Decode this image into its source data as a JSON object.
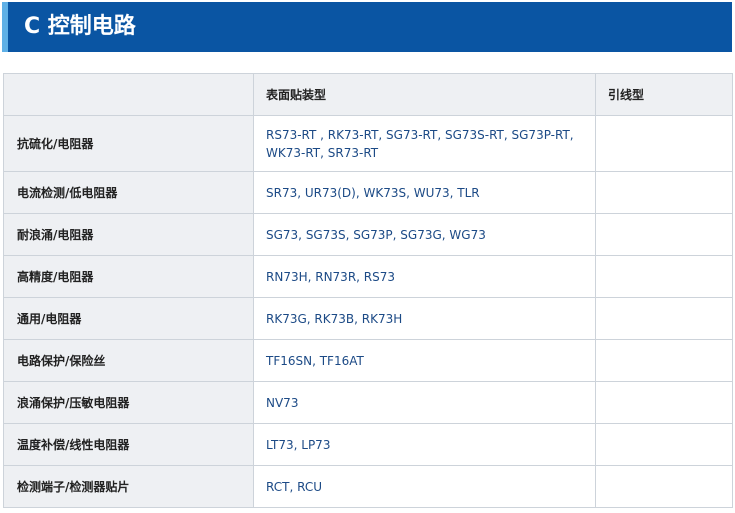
{
  "section": {
    "title": "C 控制电路"
  },
  "table": {
    "headers": [
      "",
      "表面贴装型",
      "引线型"
    ],
    "rows": [
      {
        "category": "抗硫化/电阻器",
        "smd": "RS73-RT , RK73-RT, SG73-RT, SG73S-RT, SG73P-RT, WK73-RT, SR73-RT",
        "leaded": ""
      },
      {
        "category": "电流检测/低电阻器",
        "smd": "SR73, UR73(D), WK73S, WU73, TLR",
        "leaded": ""
      },
      {
        "category": "耐浪涌/电阻器",
        "smd": "SG73, SG73S, SG73P, SG73G, WG73",
        "leaded": ""
      },
      {
        "category": "高精度/电阻器",
        "smd": "RN73H, RN73R, RS73",
        "leaded": ""
      },
      {
        "category": "通用/电阻器",
        "smd": "RK73G, RK73B, RK73H",
        "leaded": ""
      },
      {
        "category": "电路保护/保险丝",
        "smd": "TF16SN, TF16AT",
        "leaded": ""
      },
      {
        "category": "浪涌保护/压敏电阻器",
        "smd": "NV73",
        "leaded": ""
      },
      {
        "category": "温度补偿/线性电阻器",
        "smd": "LT73, LP73",
        "leaded": ""
      },
      {
        "category": "检测端子/检测器贴片",
        "smd": "RCT, RCU",
        "leaded": ""
      }
    ]
  },
  "colors": {
    "banner": "#0a55a3",
    "banner_accent": "#5fb0e6",
    "header_bg": "#eef0f3",
    "link_text": "#1c4a86"
  }
}
